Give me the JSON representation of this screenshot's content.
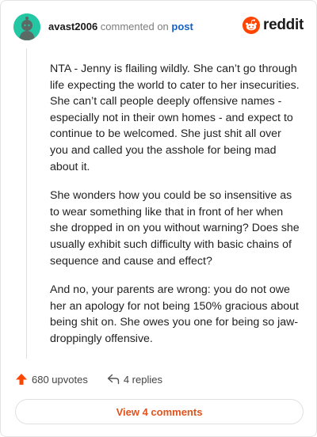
{
  "comment": {
    "username": "avast2006",
    "action_text": "commented on",
    "post_link": "post",
    "avatar_color": "#24c7a3",
    "paragraphs": [
      "NTA - Jenny is flailing wildly. She can’t go through life expecting the world to cater to her insecurities. She can’t call people deeply offensive names - especially not in their own homes - and expect to continue to be welcomed. She just shit all over you and called you the asshole for being mad about it.",
      "She wonders how you could be so insensitive as to wear something like that in front of her when she dropped in on you without warning? Does she usually exhibit such difficulty with basic chains of sequence and cause and effect?",
      "And no, your parents are wrong: you do not owe her an apology for not being 150% gracious about being shit on. She owes you one for being so jaw-droppingly offensive."
    ]
  },
  "brand": {
    "name": "reddit",
    "icon": "reddit-logo-icon",
    "color": "#ff4500"
  },
  "actions": {
    "upvotes_label": "680 upvotes",
    "upvote_icon": "upvote-arrow-icon",
    "upvote_color": "#ff4500",
    "replies_label": "4 replies",
    "reply_icon": "reply-arrow-icon"
  },
  "footer": {
    "view_comments_label": "View 4 comments",
    "accent": "#e0531d"
  }
}
